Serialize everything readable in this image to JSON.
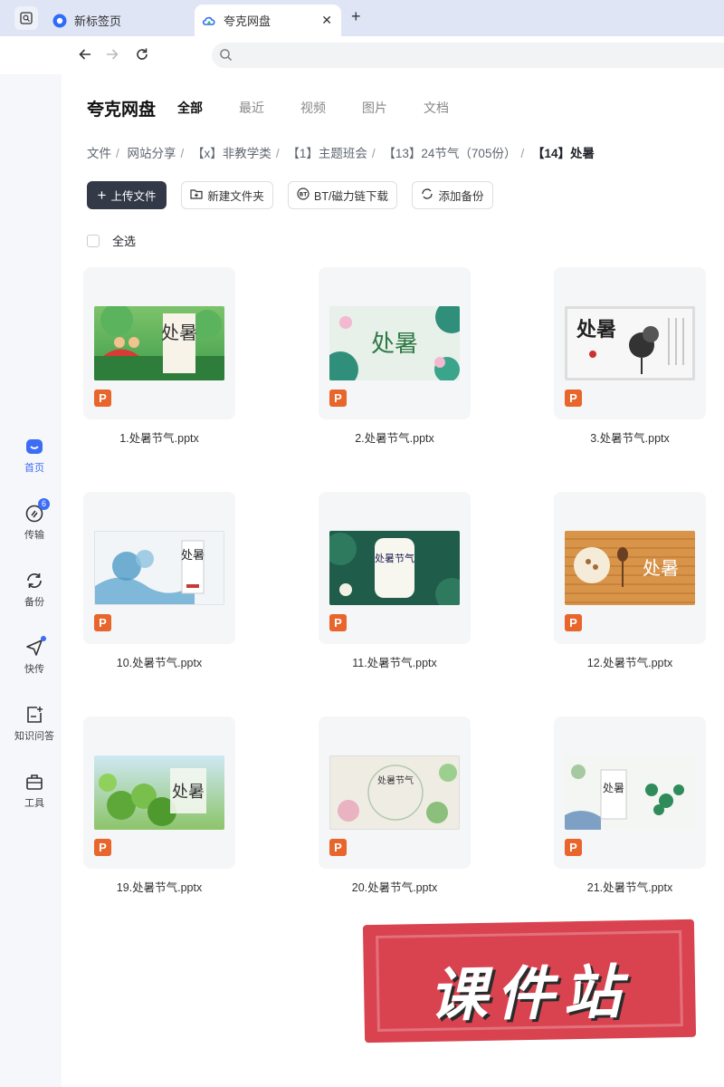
{
  "browser": {
    "tabs": [
      {
        "label": "新标签页",
        "icon": "new-tab-icon"
      },
      {
        "label": "夸克网盘",
        "icon": "cloud-drive-icon",
        "active": true
      }
    ],
    "new_tab_glyph": "+",
    "close_glyph": "✕"
  },
  "sidebar": {
    "items": [
      {
        "label": "首页",
        "icon": "home-icon",
        "active": true
      },
      {
        "label": "传输",
        "icon": "transfer-icon",
        "badge": "6"
      },
      {
        "label": "备份",
        "icon": "backup-icon"
      },
      {
        "label": "快传",
        "icon": "quick-send-icon",
        "dot": true
      },
      {
        "label": "知识问答",
        "icon": "knowledge-qa-icon"
      },
      {
        "label": "工具",
        "icon": "toolbox-icon"
      }
    ]
  },
  "header": {
    "brand": "夸克网盘",
    "tabs": [
      "全部",
      "最近",
      "视频",
      "图片",
      "文档"
    ],
    "active_tab": "全部"
  },
  "breadcrumb": [
    "文件",
    "网站分享",
    "【x】非教学类",
    "【1】主题班会",
    "【13】24节气（705份）",
    "【14】处暑"
  ],
  "toolbar": {
    "upload": "上传文件",
    "new_folder": "新建文件夹",
    "bt_download": "BT/磁力链下载",
    "add_backup": "添加备份"
  },
  "select_all": "全选",
  "files": [
    {
      "name": "1.处暑节气.pptx",
      "thumb_title": "处暑",
      "theme": "cartoon"
    },
    {
      "name": "2.处暑节气.pptx",
      "thumb_title": "处暑",
      "theme": "lotus"
    },
    {
      "name": "3.处暑节气.pptx",
      "thumb_title": "处暑",
      "theme": "ink"
    },
    {
      "name": "10.处暑节气.pptx",
      "thumb_title": "处暑",
      "theme": "watercolor"
    },
    {
      "name": "11.处暑节气.pptx",
      "thumb_title": "处暑节气",
      "theme": "dark-green"
    },
    {
      "name": "12.处暑节气.pptx",
      "thumb_title": "处暑",
      "theme": "wood"
    },
    {
      "name": "19.处暑节气.pptx",
      "thumb_title": "处暑",
      "theme": "leaves"
    },
    {
      "name": "20.处暑节气.pptx",
      "thumb_title": "处暑节气",
      "theme": "classic"
    },
    {
      "name": "21.处暑节气.pptx",
      "thumb_title": "处暑",
      "theme": "lily-pad"
    }
  ],
  "file_badge": "P",
  "watermark": "课件站",
  "colors": {
    "accent": "#3d6df5",
    "primary_button": "#333947",
    "ppt_badge": "#e8652b",
    "stamp": "#d9424f"
  }
}
